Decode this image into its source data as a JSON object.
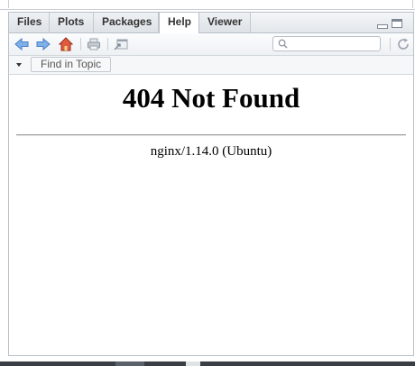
{
  "tabs": [
    "Files",
    "Plots",
    "Packages",
    "Help",
    "Viewer"
  ],
  "active_tab": "Help",
  "toolbar": {
    "icons": [
      "back-arrow-icon",
      "forward-arrow-icon",
      "home-icon",
      "print-icon",
      "open-in-window-icon",
      "search-icon",
      "refresh-icon"
    ],
    "search_placeholder": ""
  },
  "subbar": {
    "find_label": "Find in Topic"
  },
  "page": {
    "heading": "404 Not Found",
    "server": "nginx/1.14.0 (Ubuntu)"
  },
  "colors": {
    "accent_blue": "#5b8fd6",
    "home_red": "#c8392b",
    "border": "#b9c0c8"
  }
}
